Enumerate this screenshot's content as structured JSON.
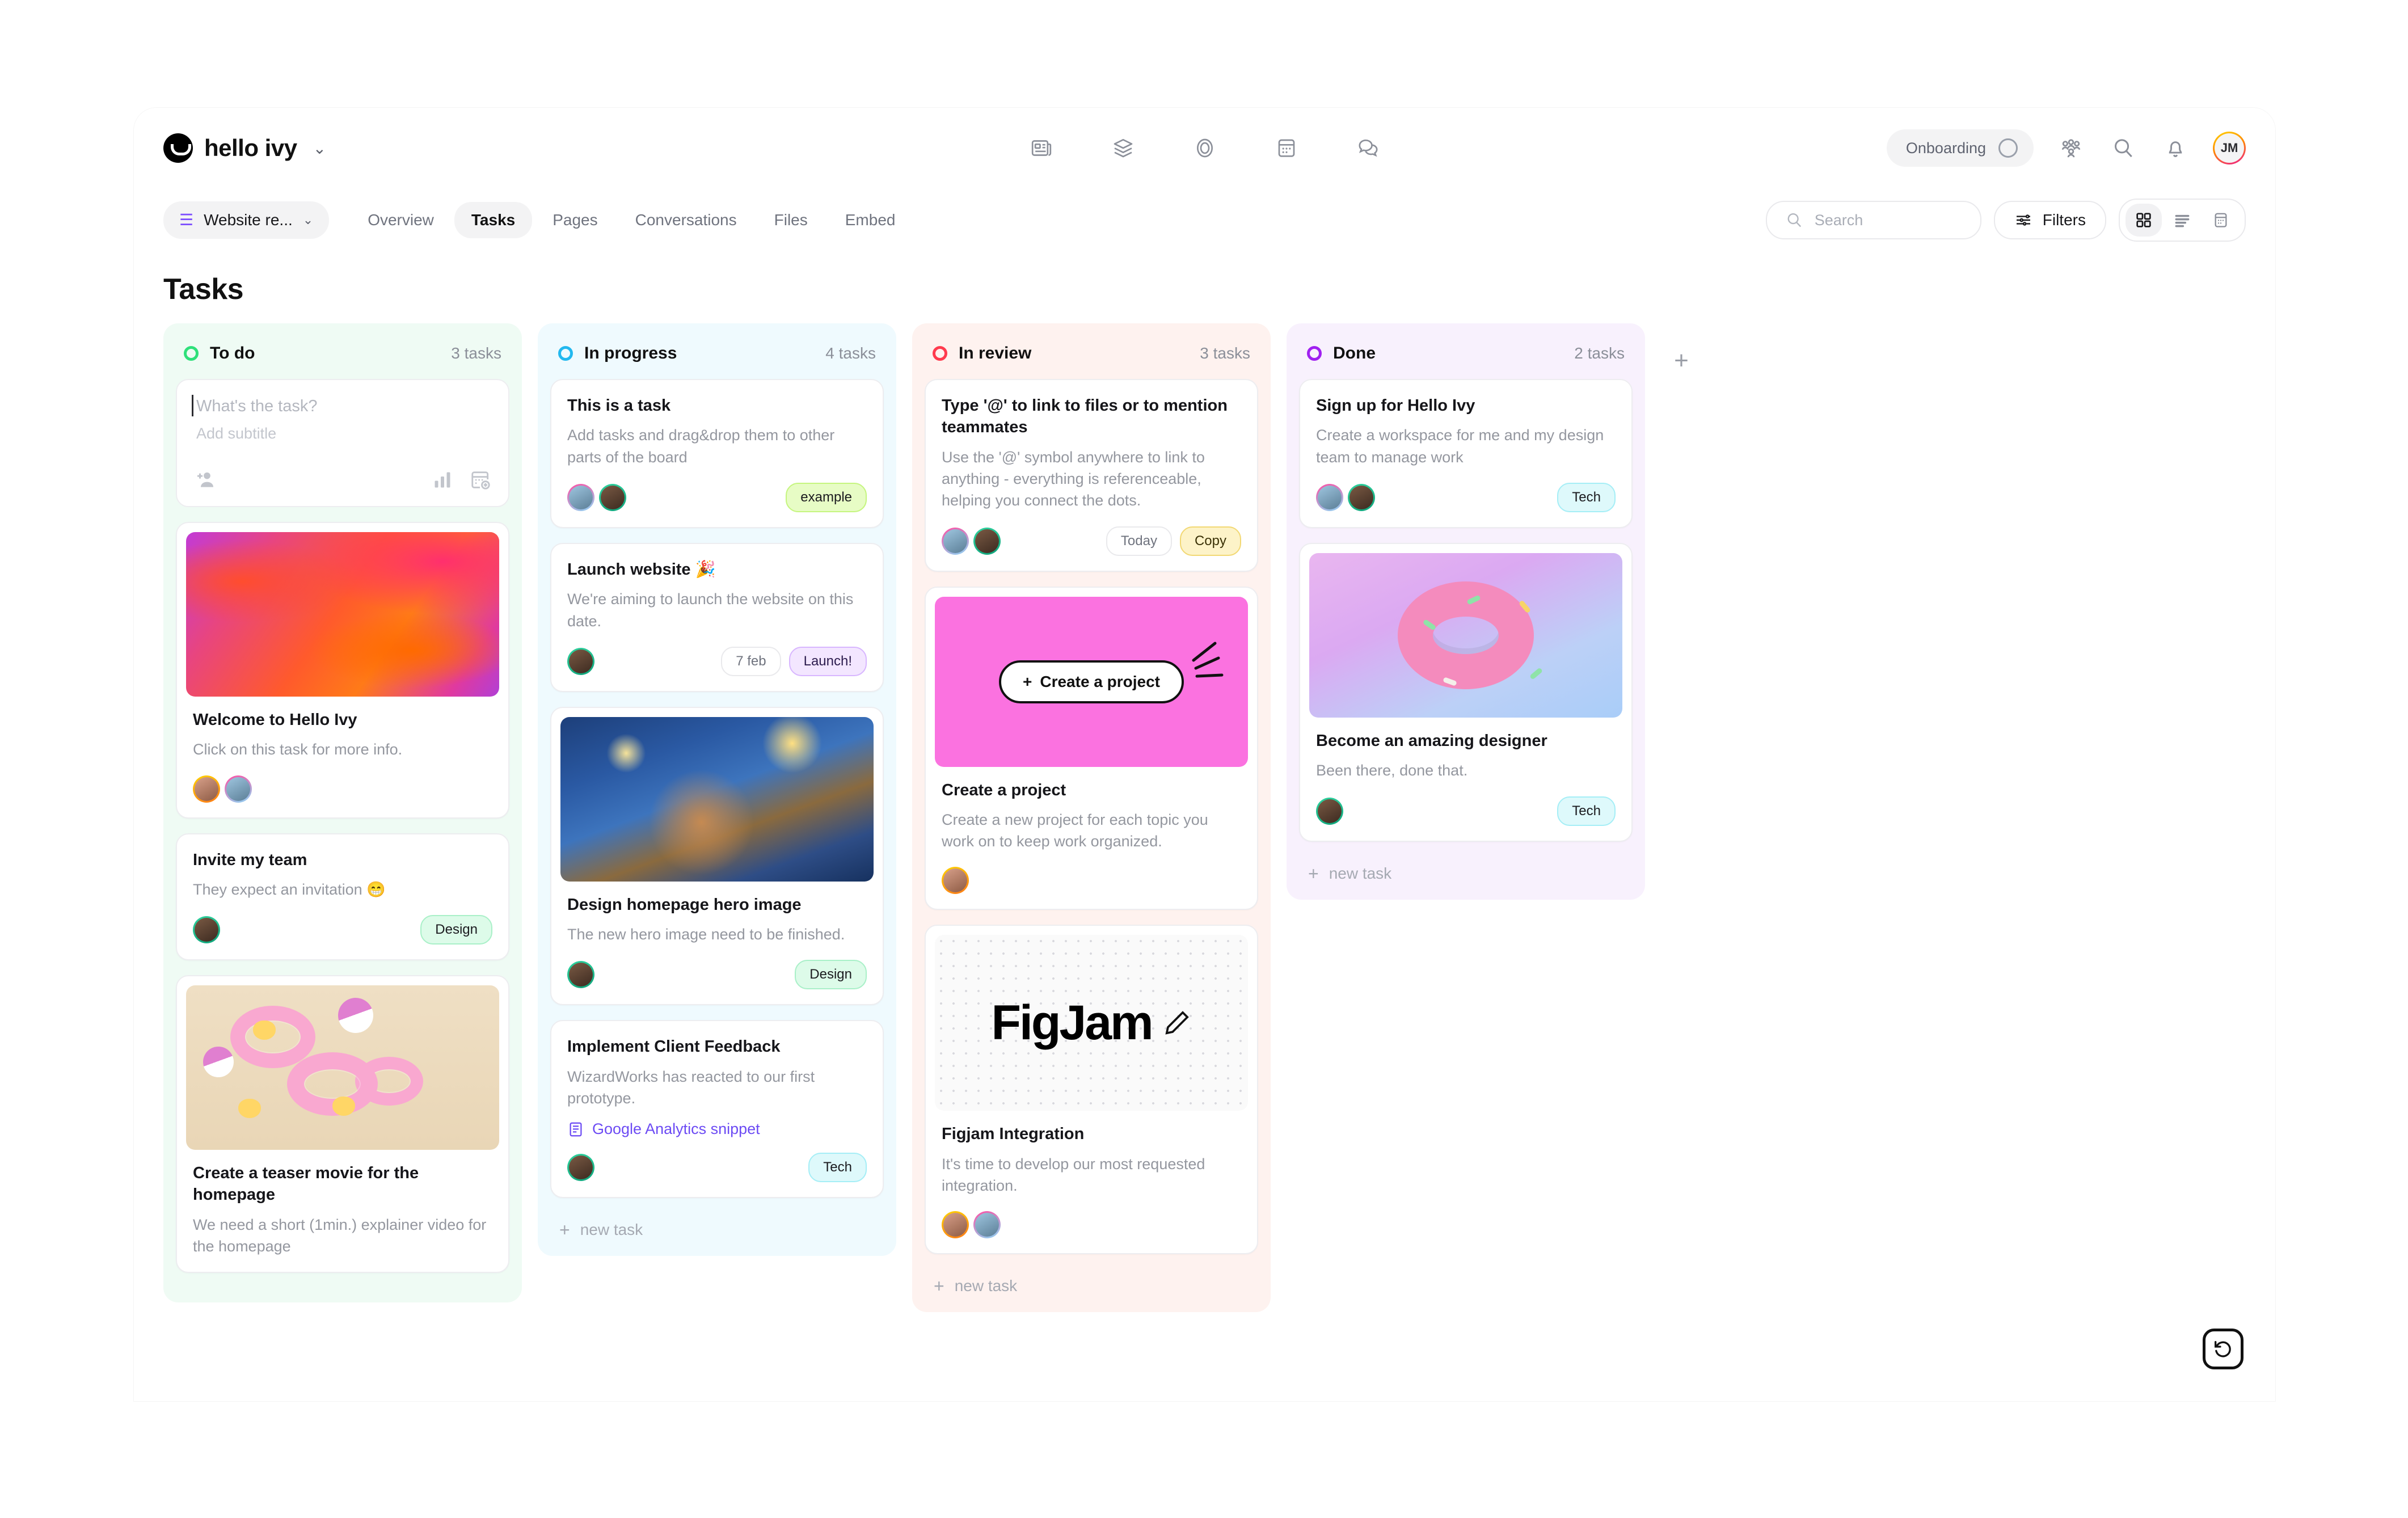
{
  "header": {
    "brand": "hello ivy",
    "brand_caret": "⌄",
    "center_icons": [
      "news-icon",
      "layers-icon",
      "target-icon",
      "calendar-icon",
      "chat-icon"
    ],
    "onboarding_label": "Onboarding",
    "right_icons": [
      "people-icon",
      "search-icon",
      "bell-icon"
    ],
    "avatar_initials": "JM"
  },
  "subnav": {
    "project_label": "Website re...",
    "project_caret": "⌄",
    "tabs": [
      {
        "label": "Overview",
        "active": false
      },
      {
        "label": "Tasks",
        "active": true
      },
      {
        "label": "Pages",
        "active": false
      },
      {
        "label": "Conversations",
        "active": false
      },
      {
        "label": "Files",
        "active": false
      },
      {
        "label": "Embed",
        "active": false
      }
    ],
    "search_placeholder": "Search",
    "filters_label": "Filters",
    "views": [
      {
        "name": "grid-view",
        "active": true
      },
      {
        "name": "list-view",
        "active": false
      },
      {
        "name": "calendar-view",
        "active": false
      }
    ]
  },
  "page_title": "Tasks",
  "board": {
    "add_column_label": "+",
    "columns": [
      {
        "name": "To do",
        "count": "3 tasks",
        "dot_color": "#2fe07a",
        "bg": "#effbf4",
        "composer": {
          "title_placeholder": "What's the task?",
          "subtitle_placeholder": "Add subtitle",
          "icons": [
            "add-person-icon",
            "priority-icon",
            "due-date-icon"
          ]
        },
        "cards": [
          {
            "cover": "abstract",
            "title": "Welcome to Hello Ivy",
            "subtitle": "Click on this task for more info.",
            "avatars": [
              "#f4b740",
              "#e879a6"
            ],
            "tags": []
          },
          {
            "cover": null,
            "title": "Invite my team",
            "subtitle": "They expect an invitation 😁",
            "avatars": [
              "#2fd4a0"
            ],
            "tags": [
              {
                "label": "Design",
                "bg": "#ddfbe9",
                "fg": "#1b1b1f",
                "border": "#a9f0c8"
              }
            ]
          },
          {
            "cover": "pool",
            "title": "Create a teaser movie for the homepage",
            "subtitle": "We need a short (1min.) explainer video for the homepage",
            "avatars": [],
            "tags": []
          }
        ],
        "new_task_label": ""
      },
      {
        "name": "In progress",
        "count": "4 tasks",
        "dot_color": "#22b8ef",
        "bg": "#effafe",
        "composer": null,
        "cards": [
          {
            "cover": null,
            "title": "This is a task",
            "subtitle": "Add tasks and drag&drop them to other parts of the board",
            "avatars": [
              "#e879a6",
              "#2fd4a0"
            ],
            "tags": [
              {
                "label": "example",
                "bg": "#e7fcc5",
                "fg": "#1b1b1f",
                "border": "#c5f57f"
              }
            ]
          },
          {
            "cover": null,
            "title": "Launch website 🎉",
            "subtitle": "We're aiming to launch the website on this date.",
            "avatars": [
              "#2fd4a0"
            ],
            "tags": [
              {
                "label": "7 feb",
                "bg": "#ffffff",
                "fg": "#6f737e",
                "border": "#e9e9ec"
              },
              {
                "label": "Launch!",
                "bg": "#f3e6ff",
                "fg": "#2b1b4d",
                "border": "#d8b6ff"
              }
            ]
          },
          {
            "cover": "starry",
            "title": "Design homepage hero image",
            "subtitle": "The new hero image need to be finished.",
            "avatars": [
              "#2fd4a0"
            ],
            "tags": [
              {
                "label": "Design",
                "bg": "#ddfbe9",
                "fg": "#1b1b1f",
                "border": "#a9f0c8"
              }
            ]
          },
          {
            "cover": null,
            "title": "Implement Client Feedback",
            "subtitle": "WizardWorks has reacted to our first prototype.",
            "link": "Google Analytics snippet",
            "avatars": [
              "#2fd4a0"
            ],
            "tags": [
              {
                "label": "Tech",
                "bg": "#def9fb",
                "fg": "#1b1b1f",
                "border": "#a5eef6"
              }
            ]
          }
        ],
        "new_task_label": "new task"
      },
      {
        "name": "In review",
        "count": "3 tasks",
        "dot_color": "#ff3b4e",
        "bg": "#fef2ef",
        "composer": null,
        "cards": [
          {
            "cover": null,
            "title": "Type '@' to link to files or to mention teammates",
            "subtitle": "Use the '@' symbol anywhere to link to anything - everything is referenceable, helping you connect the dots.",
            "avatars": [
              "#e879a6",
              "#2fd4a0"
            ],
            "tags": [
              {
                "label": "Today",
                "bg": "#ffffff",
                "fg": "#6f737e",
                "border": "#e9e9ec"
              },
              {
                "label": "Copy",
                "bg": "#fdf3c8",
                "fg": "#3a3106",
                "border": "#f2d873"
              }
            ]
          },
          {
            "cover": "pink",
            "cover_button": "Create a project",
            "title": "Create a project",
            "subtitle": "Create a new project for each topic you work on to keep work organized.",
            "avatars": [
              "#f4b740"
            ],
            "tags": []
          },
          {
            "cover": "figjam",
            "cover_word": "FigJam",
            "title": "Figjam Integration",
            "subtitle": "It's time to develop our most requested integration.",
            "avatars": [
              "#f4b740",
              "#e879a6"
            ],
            "tags": []
          }
        ],
        "new_task_label": "new task"
      },
      {
        "name": "Done",
        "count": "2 tasks",
        "dot_color": "#a020f0",
        "bg": "#f8f1fd",
        "composer": null,
        "cards": [
          {
            "cover": null,
            "title": "Sign up for Hello Ivy",
            "subtitle": "Create a workspace for me and my design team to manage work",
            "avatars": [
              "#e879a6",
              "#2fd4a0"
            ],
            "tags": [
              {
                "label": "Tech",
                "bg": "#def9fb",
                "fg": "#1b1b1f",
                "border": "#a5eef6"
              }
            ]
          },
          {
            "cover": "donut",
            "title": "Become an amazing designer",
            "subtitle": "Been there, done that.",
            "avatars": [
              "#2fd4a0"
            ],
            "tags": [
              {
                "label": "Tech",
                "bg": "#def9fb",
                "fg": "#1b1b1f",
                "border": "#a5eef6"
              }
            ]
          }
        ],
        "new_task_label": "new task"
      }
    ]
  },
  "fab": {
    "name": "reload-icon"
  }
}
